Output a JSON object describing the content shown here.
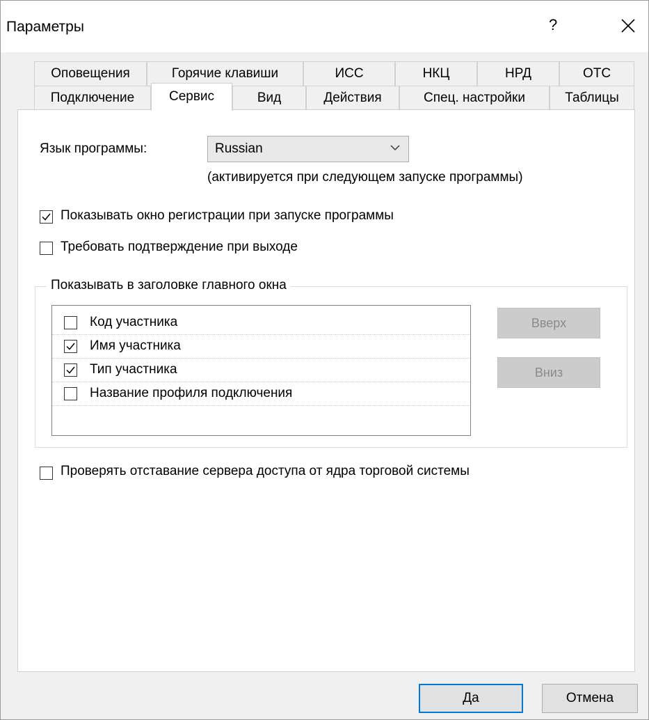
{
  "window": {
    "title": "Параметры",
    "help_label": "?"
  },
  "tabs_row1": [
    "Оповещения",
    "Горячие клавиши",
    "ИСС",
    "НКЦ",
    "НРД",
    "ОТС"
  ],
  "tabs_row2": [
    "Подключение",
    "Сервис",
    "Вид",
    "Действия",
    "Спец. настройки",
    "Таблицы"
  ],
  "active_tab": "Сервис",
  "language": {
    "label": "Язык программы:",
    "value": "Russian",
    "note": "(активируется при следующем запуске программы)"
  },
  "options": {
    "show_login": {
      "label": "Показывать окно регистрации при запуске программы",
      "checked": true
    },
    "confirm_exit": {
      "label": "Требовать подтверждение при выходе",
      "checked": false
    }
  },
  "title_group": {
    "label": "Показывать в заголовке главного окна",
    "items": [
      {
        "label": "Код участника",
        "checked": false
      },
      {
        "label": "Имя участника",
        "checked": true
      },
      {
        "label": "Тип участника",
        "checked": true
      },
      {
        "label": "Название профиля подключения",
        "checked": false
      }
    ],
    "up_label": "Вверх",
    "down_label": "Вниз"
  },
  "check_lag": {
    "label": "Проверять отставание сервера доступа от ядра торговой системы",
    "checked": false
  },
  "buttons": {
    "ok": "Да",
    "cancel": "Отмена"
  }
}
